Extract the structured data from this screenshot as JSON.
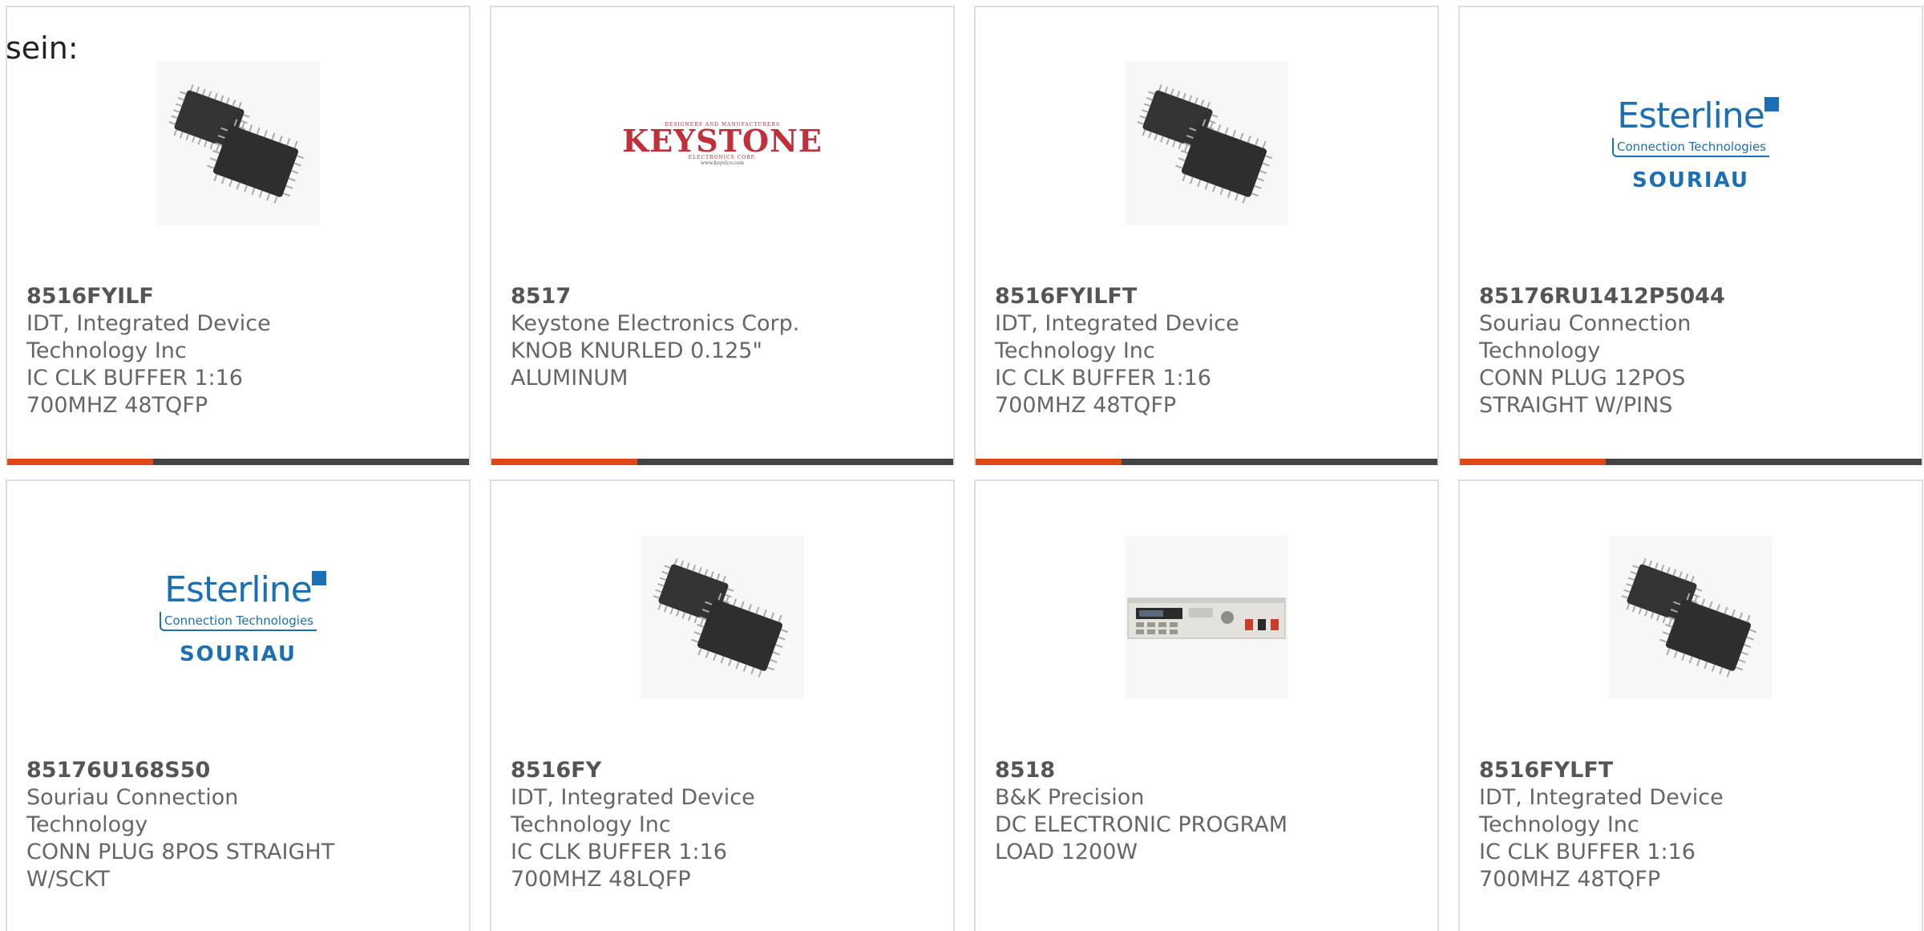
{
  "page": {
    "lead_text": "sein:"
  },
  "colors": {
    "accent_bar": "#e04616",
    "bar_base": "#444444",
    "esterline_blue": "#1b6fb4",
    "keystone_red": "#c0303b"
  },
  "products": [
    {
      "part_number": "8516FYILF",
      "manufacturer": "IDT, Integrated Device Technology Inc",
      "description": "IC CLK BUFFER 1:16 700MHZ 48TQFP",
      "image": "ic-chip-icon"
    },
    {
      "part_number": "8517",
      "manufacturer": "Keystone Electronics Corp.",
      "description": "KNOB KNURLED 0.125\" ALUMINUM",
      "image": "keystone-logo",
      "logo": {
        "top": "DESIGNERS AND MANUFACTURERS",
        "word": "KEYSTONE",
        "bottom": "ELECTRONICS CORP.",
        "url": "www.keyelco.com"
      }
    },
    {
      "part_number": "8516FYILFT",
      "manufacturer": "IDT, Integrated Device Technology Inc",
      "description": "IC CLK BUFFER 1:16 700MHZ 48TQFP",
      "image": "ic-chip-icon"
    },
    {
      "part_number": "85176RU1412P5044",
      "manufacturer": "Souriau Connection Technology",
      "description": "CONN PLUG 12POS STRAIGHT W/PINS",
      "image": "esterline-logo",
      "logo": {
        "name": "Esterline",
        "sub": "Connection Technologies",
        "brand": "SOURIAU"
      }
    },
    {
      "part_number": "85176U168S50",
      "manufacturer": "Souriau Connection Technology",
      "description": "CONN PLUG 8POS STRAIGHT W/SCKT",
      "image": "esterline-logo",
      "logo": {
        "name": "Esterline",
        "sub": "Connection Technologies",
        "brand": "SOURIAU"
      }
    },
    {
      "part_number": "8516FY",
      "manufacturer": "IDT, Integrated Device Technology Inc",
      "description": "IC CLK BUFFER 1:16 700MHZ 48LQFP",
      "image": "ic-chip-icon"
    },
    {
      "part_number": "8518",
      "manufacturer": "B&K Precision",
      "description": "DC ELECTRONIC PROGRAM LOAD 1200W",
      "image": "electronic-load-icon"
    },
    {
      "part_number": "8516FYLFT",
      "manufacturer": "IDT, Integrated Device Technology Inc",
      "description": "IC CLK BUFFER 1:16 700MHZ 48TQFP",
      "image": "ic-chip-icon"
    }
  ]
}
